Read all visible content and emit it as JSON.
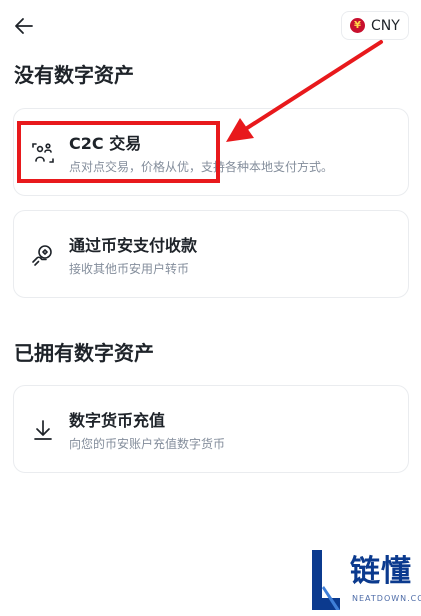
{
  "header": {
    "back_icon": "arrow-left-icon",
    "currency": {
      "flag_glyph": "¥",
      "code": "CNY",
      "flag_color": "#c8102e"
    }
  },
  "sections": [
    {
      "title": "没有数字资产",
      "items": [
        {
          "icon": "p2p-users-icon",
          "title": "C2C 交易",
          "subtitle": "点对点交易，价格从优，支持各种本地支付方式。"
        },
        {
          "icon": "pay-receive-icon",
          "title": "通过币安支付收款",
          "subtitle": "接收其他币安用户转币"
        }
      ]
    },
    {
      "title": "已拥有数字资产",
      "items": [
        {
          "icon": "download-arrow-icon",
          "title": "数字货币充值",
          "subtitle": "向您的币安账户充值数字货币"
        }
      ]
    }
  ],
  "annotation": {
    "color": "#e8191c"
  },
  "watermark": {
    "text": "链懂",
    "subtext": "NEATDOWN.COM",
    "color": "#0b3a8e"
  }
}
